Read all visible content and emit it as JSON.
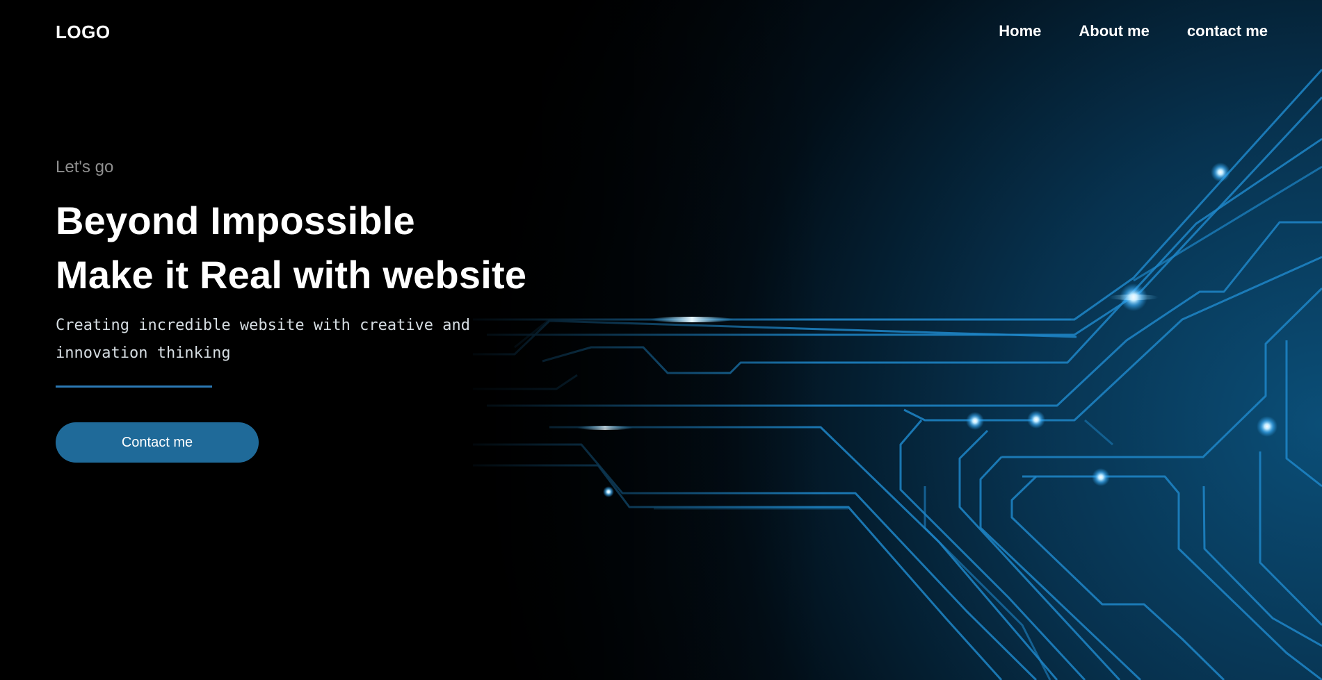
{
  "header": {
    "logo": "LOGO",
    "nav": [
      {
        "label": "Home"
      },
      {
        "label": "About me"
      },
      {
        "label": "contact me"
      }
    ]
  },
  "hero": {
    "eyebrow": "Let's go",
    "headline_line1": "Beyond Impossible",
    "headline_line2": "Make it Real with website",
    "subtext": "Creating incredible website with creative and innovation thinking",
    "cta_label": "Contact me"
  },
  "colors": {
    "background": "#000000",
    "accent": "#1f6a99",
    "divider": "#2c79b5",
    "circuit_glow": "#2a9be0"
  },
  "icons": {
    "background_art": "circuit-board-illustration"
  }
}
